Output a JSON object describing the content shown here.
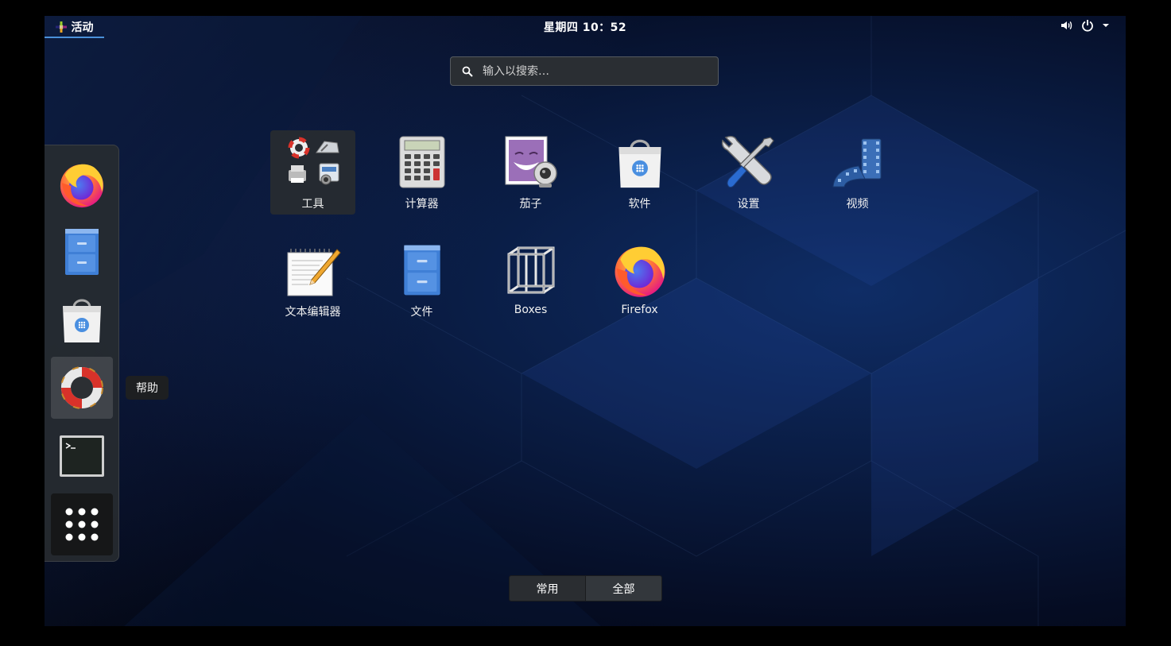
{
  "topbar": {
    "activities_label": "活动",
    "clock": "星期四 10：52"
  },
  "search": {
    "placeholder": "输入以搜索…"
  },
  "dash": {
    "items": [
      {
        "name": "firefox",
        "icon": "firefox-icon"
      },
      {
        "name": "files",
        "icon": "file-cabinet-icon"
      },
      {
        "name": "software",
        "icon": "shopping-bag-icon"
      },
      {
        "name": "help",
        "icon": "lifebuoy-icon",
        "active": true
      },
      {
        "name": "terminal",
        "icon": "terminal-icon"
      },
      {
        "name": "show-applications",
        "icon": "app-grid-icon"
      }
    ],
    "tooltip": "帮助"
  },
  "apps": [
    {
      "label": "工具",
      "icon": "utilities-folder-icon"
    },
    {
      "label": "计算器",
      "icon": "calculator-icon"
    },
    {
      "label": "茄子",
      "icon": "cheese-webcam-icon"
    },
    {
      "label": "软件",
      "icon": "shopping-bag-icon"
    },
    {
      "label": "设置",
      "icon": "wrench-screwdriver-icon"
    },
    {
      "label": "视频",
      "icon": "film-reel-icon"
    },
    {
      "label": "文本编辑器",
      "icon": "notepad-pencil-icon"
    },
    {
      "label": "文件",
      "icon": "file-cabinet-icon"
    },
    {
      "label": "Boxes",
      "icon": "wireframe-cube-icon"
    },
    {
      "label": "Firefox",
      "icon": "firefox-icon"
    }
  ],
  "view_switch": {
    "frequent": "常用",
    "all": "全部"
  }
}
